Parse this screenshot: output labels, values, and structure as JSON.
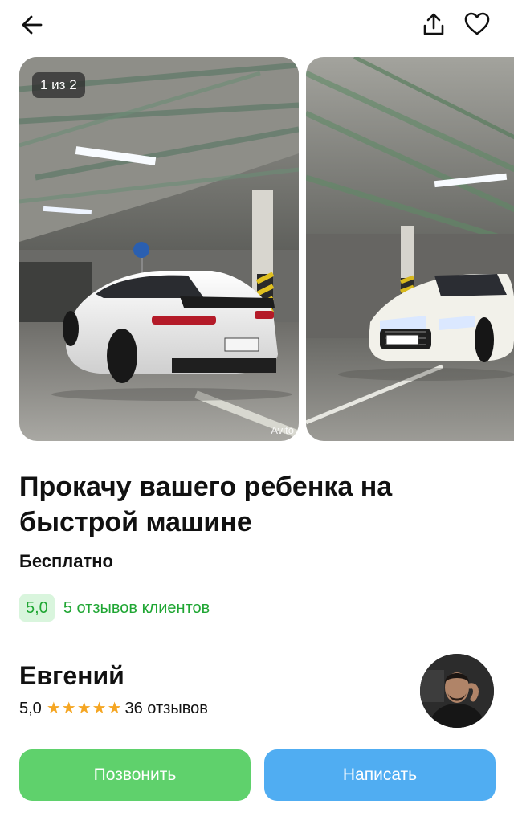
{
  "header": {
    "back_icon": "arrow-left-icon",
    "share_icon": "share-icon",
    "favorite_icon": "heart-icon"
  },
  "gallery": {
    "counter": "1 из 2",
    "watermark": "Avito"
  },
  "listing": {
    "title": "Прокачу вашего ребенка на быстрой машине",
    "price": "Бесплатно",
    "rating": "5,0",
    "reviews_link": "5 отзывов клиентов"
  },
  "seller": {
    "name": "Евгений",
    "rating": "5,0",
    "stars": 5,
    "reviews": "36 отзывов"
  },
  "actions": {
    "call_label": "Позвонить",
    "write_label": "Написать"
  },
  "colors": {
    "accent_green": "#5fd16c",
    "accent_blue": "#50adf2",
    "rating_green": "#1fa633",
    "star": "#f5a623"
  }
}
